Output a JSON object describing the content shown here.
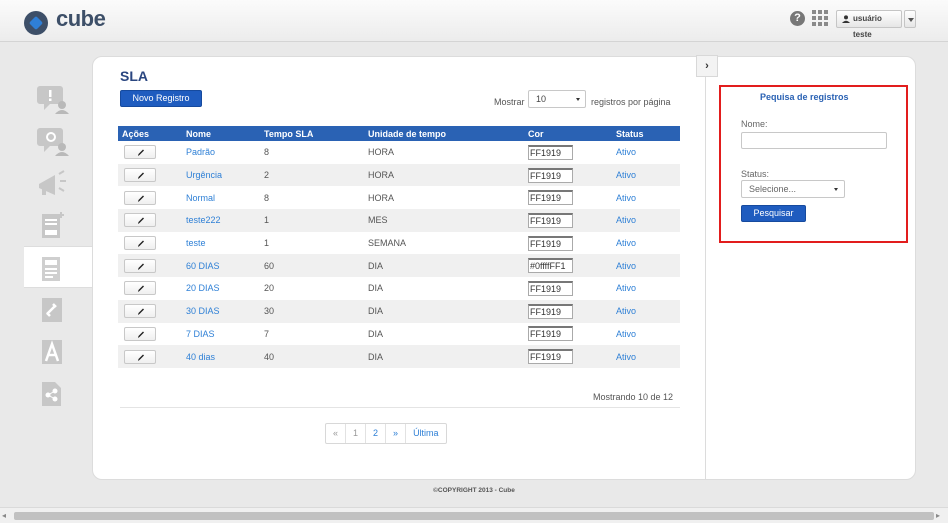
{
  "header": {
    "logo_text": "cube",
    "help_icon": "question-circle-icon",
    "apps_icon": "grid-apps-icon",
    "user_label": "usuário teste"
  },
  "sidebar": {
    "items": [
      {
        "icon": "chat-user-icon",
        "active": false
      },
      {
        "icon": "chat-support-icon",
        "active": false
      },
      {
        "icon": "megaphone-icon",
        "active": false
      },
      {
        "icon": "add-document-icon",
        "active": false
      },
      {
        "icon": "sla-document-icon",
        "active": true
      },
      {
        "icon": "edit-link-icon",
        "active": false
      },
      {
        "icon": "letter-a-icon",
        "active": false
      },
      {
        "icon": "workflow-document-icon",
        "active": false
      }
    ]
  },
  "main": {
    "title": "SLA",
    "new_button": "Novo Registro",
    "show_label": "Mostrar",
    "show_value": "10",
    "per_page_label": "registros por página",
    "columns": [
      "Ações",
      "Nome",
      "Tempo SLA",
      "Unidade de tempo",
      "Cor",
      "Status"
    ],
    "rows": [
      {
        "nome": "Padrão",
        "tempo": "8",
        "unidade": "HORA",
        "cor": "FF1919",
        "status": "Ativo"
      },
      {
        "nome": "Urgência",
        "tempo": "2",
        "unidade": "HORA",
        "cor": "FF1919",
        "status": "Ativo"
      },
      {
        "nome": "Normal",
        "tempo": "8",
        "unidade": "HORA",
        "cor": "FF1919",
        "status": "Ativo"
      },
      {
        "nome": "teste222",
        "tempo": "1",
        "unidade": "MES",
        "cor": "FF1919",
        "status": "Ativo"
      },
      {
        "nome": "teste",
        "tempo": "1",
        "unidade": "SEMANA",
        "cor": "FF1919",
        "status": "Ativo"
      },
      {
        "nome": "60 DIAS",
        "tempo": "60",
        "unidade": "DIA",
        "cor": "#0ffffFF1",
        "status": "Ativo"
      },
      {
        "nome": "20 DIAS",
        "tempo": "20",
        "unidade": "DIA",
        "cor": "FF1919",
        "status": "Ativo"
      },
      {
        "nome": "30 DIAS",
        "tempo": "30",
        "unidade": "DIA",
        "cor": "FF1919",
        "status": "Ativo"
      },
      {
        "nome": "7 DIAS",
        "tempo": "7",
        "unidade": "DIA",
        "cor": "FF1919",
        "status": "Ativo"
      },
      {
        "nome": "40 dias",
        "tempo": "40",
        "unidade": "DIA",
        "cor": "FF1919",
        "status": "Ativo"
      }
    ],
    "showing_text": "Mostrando 10 de 12",
    "pagination": {
      "prev": "«",
      "pages": [
        "1",
        "2"
      ],
      "next": "»",
      "last": "Última"
    }
  },
  "search_panel": {
    "collapse_label": "›",
    "title": "Pequisa de registros",
    "name_label": "Nome:",
    "name_value": "",
    "status_label": "Status:",
    "status_value": "Selecione...",
    "search_button": "Pesquisar"
  },
  "footer": {
    "copyright": "©COPYRIGHT 2013 - Cube"
  },
  "colors": {
    "accent": "#2a62b4",
    "button": "#1f5cbf",
    "link": "#2f80d6",
    "highlight_border": "#e21d1d"
  }
}
